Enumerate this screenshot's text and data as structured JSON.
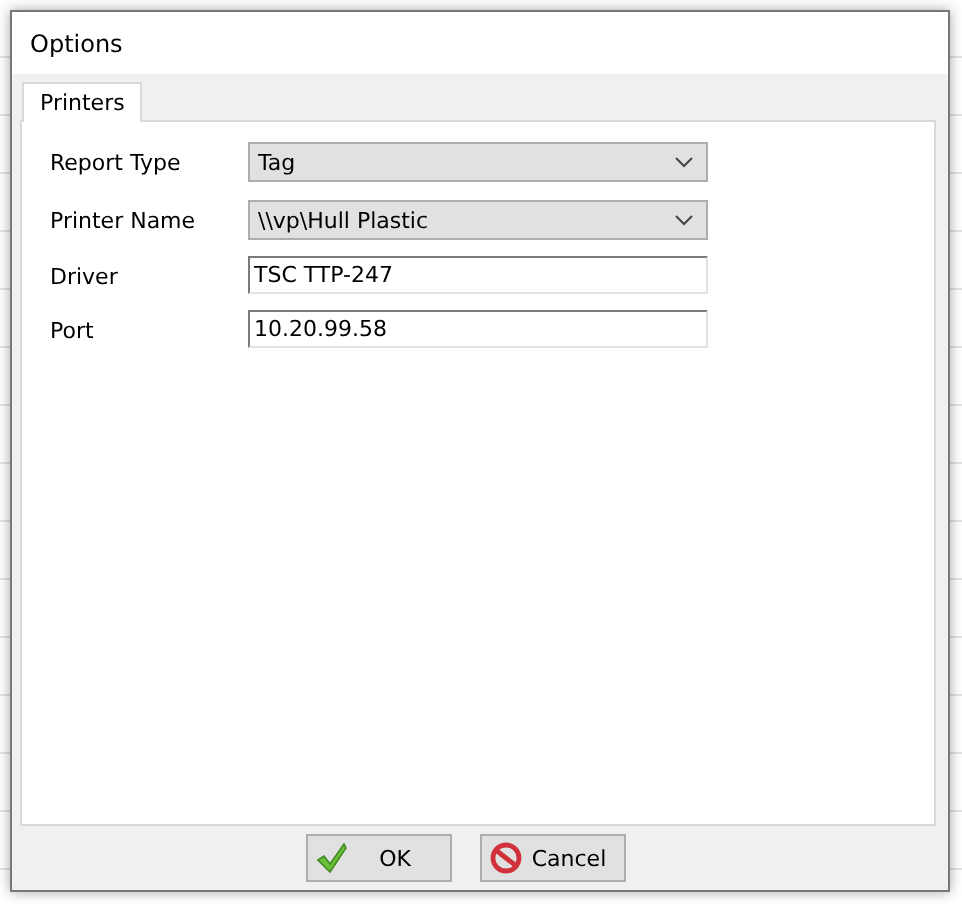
{
  "window": {
    "title": "Options"
  },
  "tabs": [
    {
      "label": "Printers",
      "selected": true
    }
  ],
  "fields": [
    {
      "kind": "dropdown",
      "label": "Report Type",
      "value": "Tag"
    },
    {
      "kind": "dropdown",
      "label": "Printer Name",
      "value": "\\\\vp\\Hull Plastic"
    },
    {
      "kind": "text",
      "label": "Driver",
      "value": "TSC TTP-247"
    },
    {
      "kind": "text",
      "label": "Port",
      "value": "10.20.99.58"
    }
  ],
  "buttons": [
    {
      "kind": "ok",
      "label": "OK"
    },
    {
      "kind": "cancel",
      "label": "Cancel"
    }
  ]
}
